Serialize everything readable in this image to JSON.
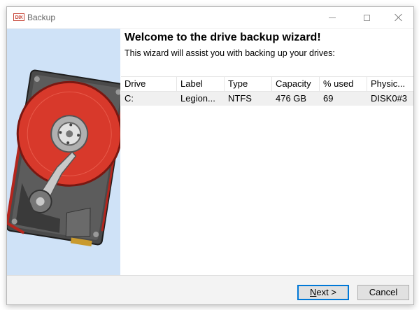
{
  "window": {
    "title": "Backup",
    "app_icon_text": "DIX"
  },
  "wizard": {
    "heading": "Welcome to the drive backup wizard!",
    "subheading": "This wizard will assist you with backing up your drives:"
  },
  "table": {
    "columns": [
      "Drive",
      "Label",
      "Type",
      "Capacity",
      "% used",
      "Physic..."
    ],
    "rows": [
      [
        "C:",
        "Legion...",
        "NTFS",
        "476 GB",
        "69",
        "DISK0#3"
      ]
    ]
  },
  "buttons": {
    "next_mnemonic": "N",
    "next_rest": "ext >",
    "cancel": "Cancel"
  },
  "colors": {
    "side_panel": "#cfe2f7",
    "accent": "#0078d7",
    "platter": "#d8392b"
  }
}
